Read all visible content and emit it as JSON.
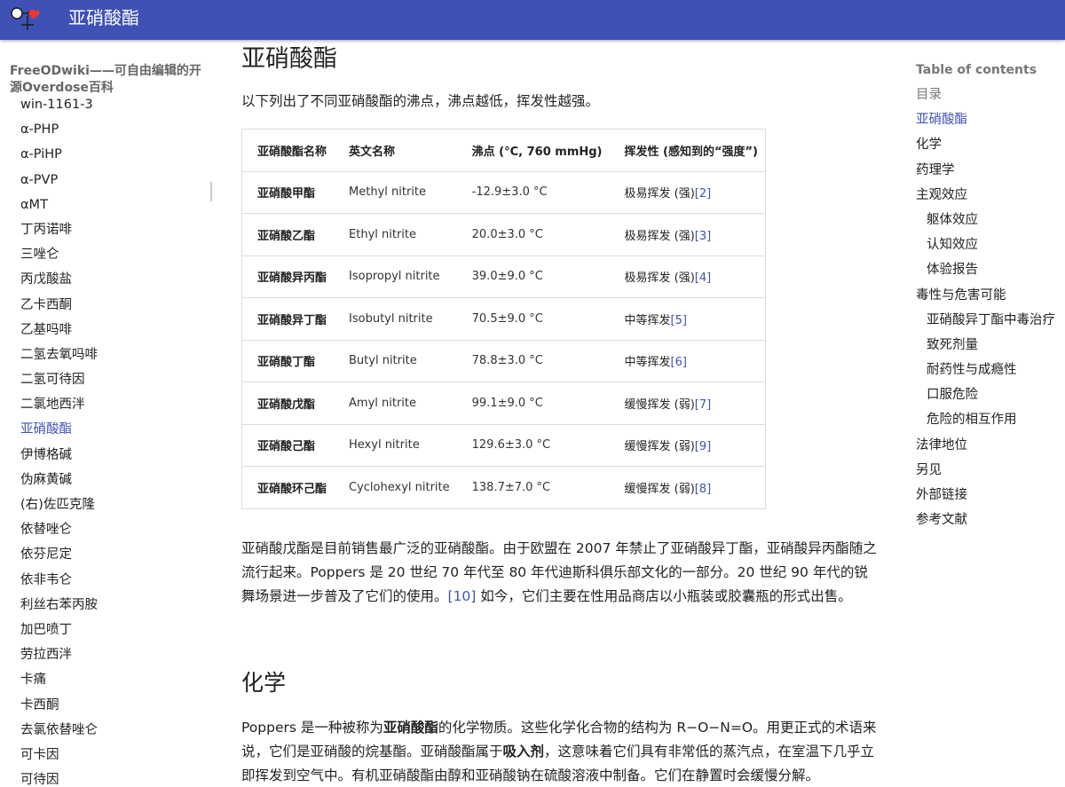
{
  "header": {
    "site_title": "亚硝酸酯"
  },
  "sidebar": {
    "wiki_name": "FreeODwiki——可自由编辑的开源Overdose百科",
    "items": [
      {
        "label": "win-1161-3"
      },
      {
        "label": "α-PHP"
      },
      {
        "label": "α-PiHP"
      },
      {
        "label": "α-PVP"
      },
      {
        "label": "αMT"
      },
      {
        "label": "丁丙诺啡"
      },
      {
        "label": "三唑仑"
      },
      {
        "label": "丙戊酸盐"
      },
      {
        "label": "乙卡西酮"
      },
      {
        "label": "乙基吗啡"
      },
      {
        "label": "二氢去氧吗啡"
      },
      {
        "label": "二氢可待因"
      },
      {
        "label": "二氯地西泮"
      },
      {
        "label": "亚硝酸酯"
      },
      {
        "label": "伊博格碱"
      },
      {
        "label": "伪麻黄碱"
      },
      {
        "label": "(右)佐匹克隆"
      },
      {
        "label": "依替唑仑"
      },
      {
        "label": "依芬尼定"
      },
      {
        "label": "依非韦仑"
      },
      {
        "label": "利丝右苯丙胺"
      },
      {
        "label": "加巴喷丁"
      },
      {
        "label": "劳拉西泮"
      },
      {
        "label": "卡痛"
      },
      {
        "label": "卡西酮"
      },
      {
        "label": "去氯依替唑仑"
      },
      {
        "label": "可卡因"
      },
      {
        "label": "可待因"
      }
    ]
  },
  "main": {
    "title": "亚硝酸酯",
    "intro": "以下列出了不同亚硝酸酯的沸点，沸点越低，挥发性越强。",
    "table": {
      "headers": [
        "亚硝酸酯名称",
        "英文名称",
        "沸点 (°C, 760 mmHg)",
        "挥发性 (感知到的“强度”)"
      ],
      "rows": [
        {
          "name": "亚硝酸甲酯",
          "en": "Methyl nitrite",
          "bp": "-12.9±3.0 °C",
          "vol": "极易挥发 (强)",
          "ref": "[2]"
        },
        {
          "name": "亚硝酸乙酯",
          "en": "Ethyl nitrite",
          "bp": "20.0±3.0 °C",
          "vol": "极易挥发 (强)",
          "ref": "[3]"
        },
        {
          "name": "亚硝酸异丙酯",
          "en": "Isopropyl nitrite",
          "bp": "39.0±9.0 °C",
          "vol": "极易挥发 (强)",
          "ref": "[4]"
        },
        {
          "name": "亚硝酸异丁酯",
          "en": "Isobutyl nitrite",
          "bp": "70.5±9.0 °C",
          "vol": "中等挥发",
          "ref": "[5]"
        },
        {
          "name": "亚硝酸丁酯",
          "en": "Butyl nitrite",
          "bp": "78.8±3.0 °C",
          "vol": "中等挥发",
          "ref": "[6]"
        },
        {
          "name": "亚硝酸戊酯",
          "en": "Amyl nitrite",
          "bp": "99.1±9.0 °C",
          "vol": "缓慢挥发 (弱)",
          "ref": "[7]"
        },
        {
          "name": "亚硝酸己酯",
          "en": "Hexyl nitrite",
          "bp": "129.6±3.0 °C",
          "vol": "缓慢挥发 (弱)",
          "ref": "[9]"
        },
        {
          "name": "亚硝酸环己酯",
          "en": "Cyclohexyl nitrite",
          "bp": "138.7±7.0 °C",
          "vol": "缓慢挥发 (弱)",
          "ref": "[8]"
        }
      ]
    },
    "para1": {
      "text_a": "亚硝酸戊酯是目前销售最广泛的亚硝酸酯。由于欧盟在 2007 年禁止了亚硝酸异丁酯，亚硝酸异丙酯随之流行起来。Poppers 是 20 世纪 70 年代至 80 年代迪斯科俱乐部文化的一部分。20 世纪 90 年代的锐舞场景进一步普及了它们的使用。",
      "ref": "[10]",
      "text_b": " 如今，它们主要在性用品商店以小瓶装或胶囊瓶的形式出售。"
    },
    "chem_heading": "化学",
    "para2": {
      "t1": "Poppers 是一种被称为",
      "b1": "亚硝酸酯",
      "t2": "的化学物质。这些化学化合物的结构为 R−O−N=O。用更正式的术语来说，它们是亚硝酸的烷基酯。亚硝酸酯属于",
      "b2": "吸入剂",
      "t3": "，这意味着它们具有非常低的蒸汽点，在室温下几乎立即挥发到空气中。有机亚硝酸酯由醇和亚硝酸钠在硫酸溶液中制备。它们在静置时会缓慢分解。"
    }
  },
  "toc": {
    "title": "Table of contents",
    "items": [
      {
        "label": "目录"
      },
      {
        "label": "亚硝酸酯"
      },
      {
        "label": "化学"
      },
      {
        "label": "药理学"
      },
      {
        "label": "主观效应"
      },
      {
        "label": "躯体效应"
      },
      {
        "label": "认知效应"
      },
      {
        "label": "体验报告"
      },
      {
        "label": "毒性与危害可能"
      },
      {
        "label": "亚硝酸异丁酯中毒治疗"
      },
      {
        "label": "致死剂量"
      },
      {
        "label": "耐药性与成瘾性"
      },
      {
        "label": "口服危险"
      },
      {
        "label": "危险的相互作用"
      },
      {
        "label": "法律地位"
      },
      {
        "label": "另见"
      },
      {
        "label": "外部链接"
      },
      {
        "label": "参考文献"
      }
    ]
  },
  "colors": {
    "header_bg": "#3f51b5",
    "link": "#3f51b5",
    "logo_red": "#e53935"
  },
  "icons": {
    "logo": "odwiki-logo-icon"
  }
}
